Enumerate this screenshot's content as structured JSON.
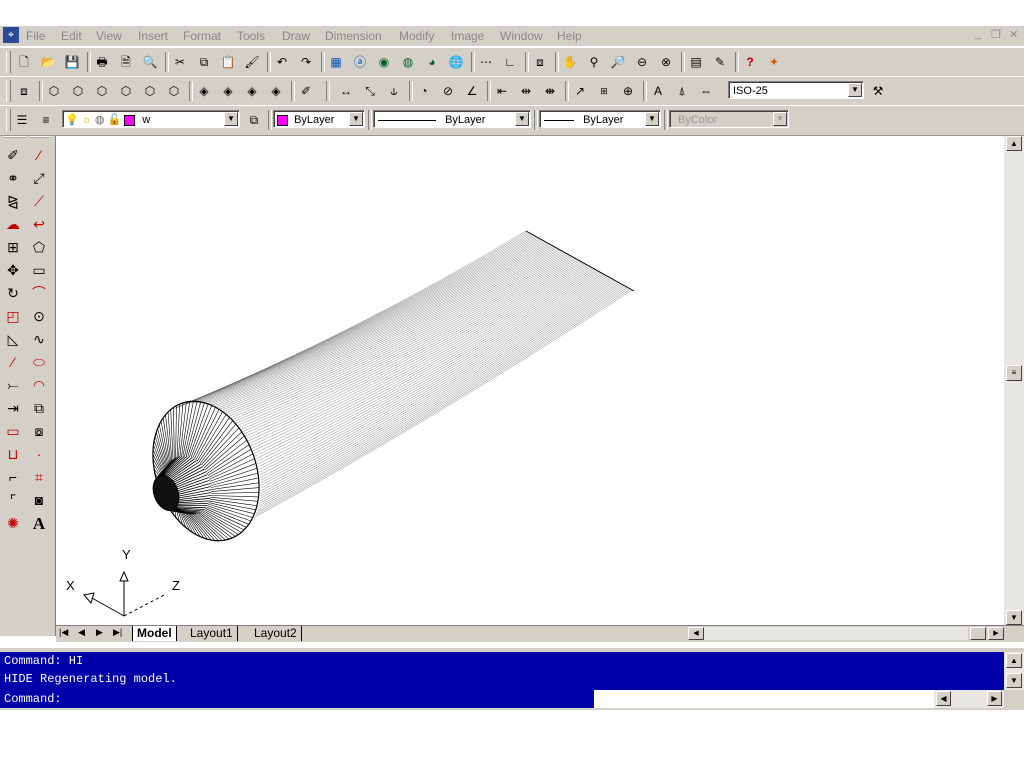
{
  "menu": {
    "items": [
      "File",
      "Edit",
      "View",
      "Insert",
      "Format",
      "Tools",
      "Draw",
      "Dimension",
      "Modify",
      "Image",
      "Window",
      "Help"
    ]
  },
  "dim_style": {
    "value": "ISO-25"
  },
  "properties": {
    "layer": "w",
    "color": "ByLayer",
    "linetype": "ByLayer",
    "lineweight": "ByLayer",
    "plotstyle": "ByColor"
  },
  "ucs": {
    "x_label": "X",
    "y_label": "Y",
    "z_label": "Z"
  },
  "layout_tabs": [
    {
      "label": "Model",
      "active": true
    },
    {
      "label": "Layout1",
      "active": false
    },
    {
      "label": "Layout2",
      "active": false
    }
  ],
  "command": {
    "history": [
      "Command: HI",
      "HIDE Regenerating model."
    ],
    "prompt": "Command:"
  },
  "colors": {
    "command_bg": "#0000a8",
    "layer_swatch": "#ff00ff",
    "chrome": "#d4d0c8"
  },
  "icons": {
    "standard": [
      "new-icon",
      "open-icon",
      "save-icon",
      "print-icon",
      "print-preview-icon",
      "spell-check-icon",
      "cut-icon",
      "copy-icon",
      "paste-icon",
      "match-properties-icon",
      "undo-icon",
      "redo-icon",
      "design-center-icon",
      "today-icon",
      "meet-now-icon",
      "publish-web-icon",
      "3d-dwf-icon",
      "hyperlink-icon",
      "snap-from-icon",
      "ucs-icon",
      "aerial-view-icon",
      "pan-icon",
      "zoom-realtime-icon",
      "zoom-window-icon",
      "zoom-previous-icon",
      "properties-icon",
      "design-tools-icon",
      "help-icon",
      "active-assistance-icon"
    ],
    "draw_col": [
      "line-icon",
      "construction-line-icon",
      "polyline-icon",
      "polygon-icon",
      "rectangle-icon",
      "arc-icon",
      "circle-icon",
      "spline-icon",
      "ellipse-icon",
      "ellipse-arc-icon",
      "insert-block-icon",
      "make-block-icon",
      "point-icon",
      "hatch-icon",
      "region-icon",
      "text-icon"
    ],
    "modify_col": [
      "erase-icon",
      "copy-object-icon",
      "mirror-icon",
      "offset-icon",
      "array-icon",
      "move-icon",
      "rotate-icon",
      "scale-icon",
      "stretch-icon",
      "trim-icon",
      "extend-icon",
      "break-icon",
      "join-icon",
      "chamfer-icon",
      "fillet-icon",
      "explode-icon"
    ]
  }
}
